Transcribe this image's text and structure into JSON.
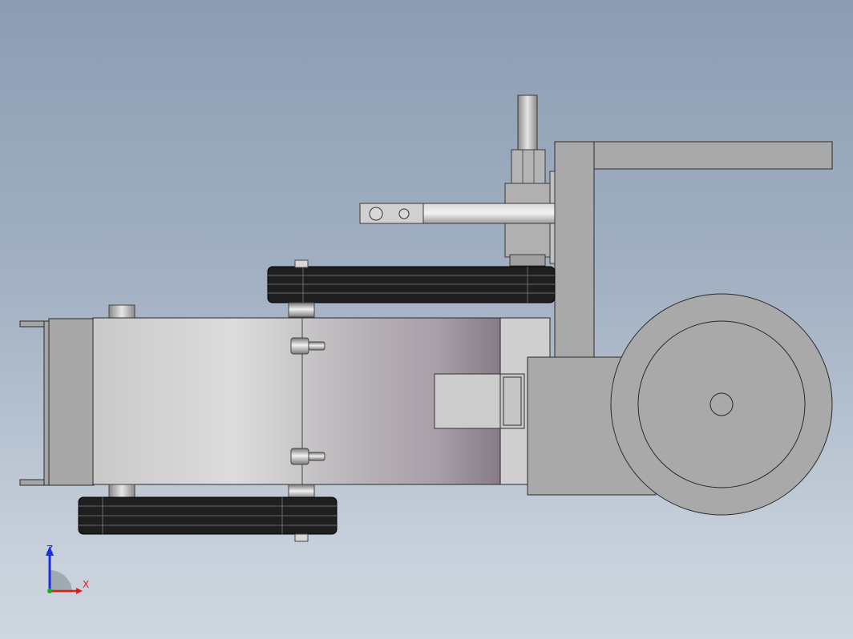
{
  "triad": {
    "z_label": "Z",
    "x_label": "X",
    "colors": {
      "z": "#1b2ee0",
      "x": "#e01b1b",
      "y": "#18b018"
    }
  },
  "colors": {
    "background_top": "#8c9db2",
    "background_bottom": "#cfd7e0",
    "part_gray": "#b0b0b0",
    "belt_black": "#1c1c1c",
    "edge": "#2a2a2a"
  }
}
